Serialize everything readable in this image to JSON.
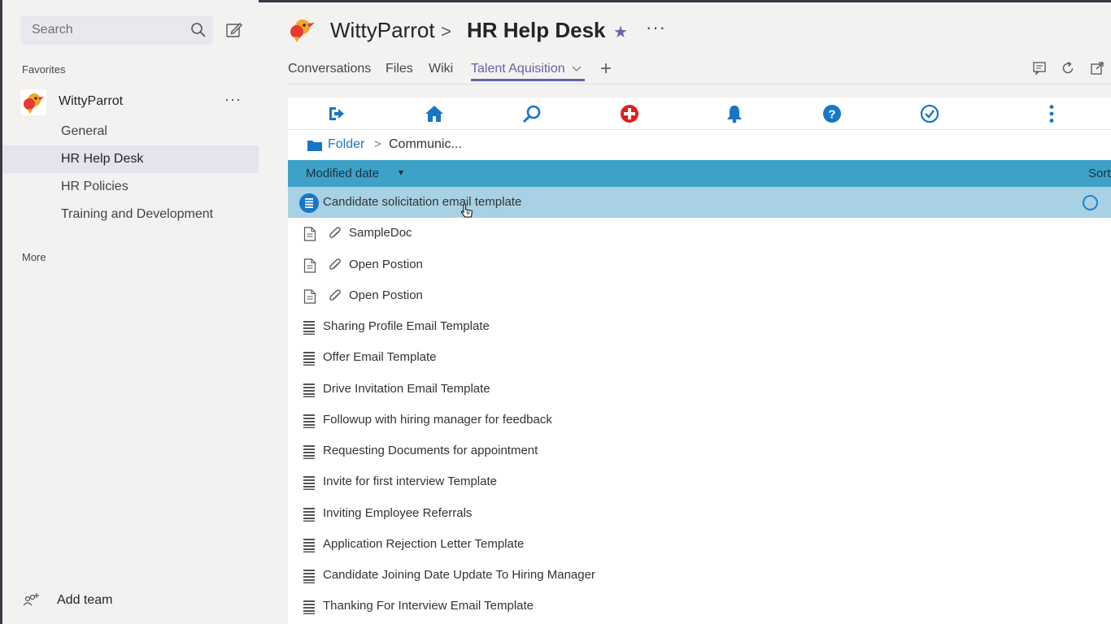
{
  "sidebar": {
    "search_placeholder": "Search",
    "favorites_label": "Favorites",
    "team_name": "WittyParrot",
    "team_more": "···",
    "channels": [
      "General",
      "HR Help Desk",
      "HR Policies",
      "Training and Development"
    ],
    "active_channel": "HR Help Desk",
    "more_label": "More",
    "add_team_label": "Add team"
  },
  "header": {
    "team": "WittyParrot",
    "separator": ">",
    "channel": "HR Help Desk",
    "more": "···",
    "tabs": [
      "Conversations",
      "Files",
      "Wiki",
      "Talent Aquisition"
    ],
    "active_tab": "Talent Aquisition",
    "add_tab": "+"
  },
  "toolbar": {
    "icons": [
      "sign-out-icon",
      "home-icon",
      "search-icon",
      "add-icon",
      "bell-icon",
      "help-icon",
      "check-circle-icon",
      "more-vertical-icon"
    ]
  },
  "breadcrumb": {
    "folder": "Folder",
    "separator": ">",
    "current": "Communic..."
  },
  "sortbar": {
    "label": "Modified date",
    "caret": "▾",
    "sort_label": "Sort"
  },
  "items": [
    {
      "name": "Candidate solicitation email template",
      "kind": "template",
      "selected": true
    },
    {
      "name": "SampleDoc",
      "kind": "attachment"
    },
    {
      "name": "Open Postion",
      "kind": "attachment"
    },
    {
      "name": "Open Postion",
      "kind": "attachment"
    },
    {
      "name": "Sharing Profile Email Template",
      "kind": "template"
    },
    {
      "name": "Offer Email Template",
      "kind": "template"
    },
    {
      "name": "Drive Invitation Email Template",
      "kind": "template"
    },
    {
      "name": "Followup with hiring manager for feedback",
      "kind": "template"
    },
    {
      "name": "Requesting Documents for appointment",
      "kind": "template"
    },
    {
      "name": "Invite for first interview Template",
      "kind": "template"
    },
    {
      "name": "Inviting Employee Referrals",
      "kind": "template"
    },
    {
      "name": "Application Rejection Letter Template",
      "kind": "template"
    },
    {
      "name": "Candidate Joining Date Update To Hiring Manager",
      "kind": "template"
    },
    {
      "name": "Thanking For Interview Email Template",
      "kind": "template"
    }
  ],
  "colors": {
    "teams_accent": "#6264a7",
    "sortbar": "#3da1c8",
    "selected_row": "#a8d2e4",
    "link_blue": "#1777c7",
    "add_red": "#e02020"
  }
}
